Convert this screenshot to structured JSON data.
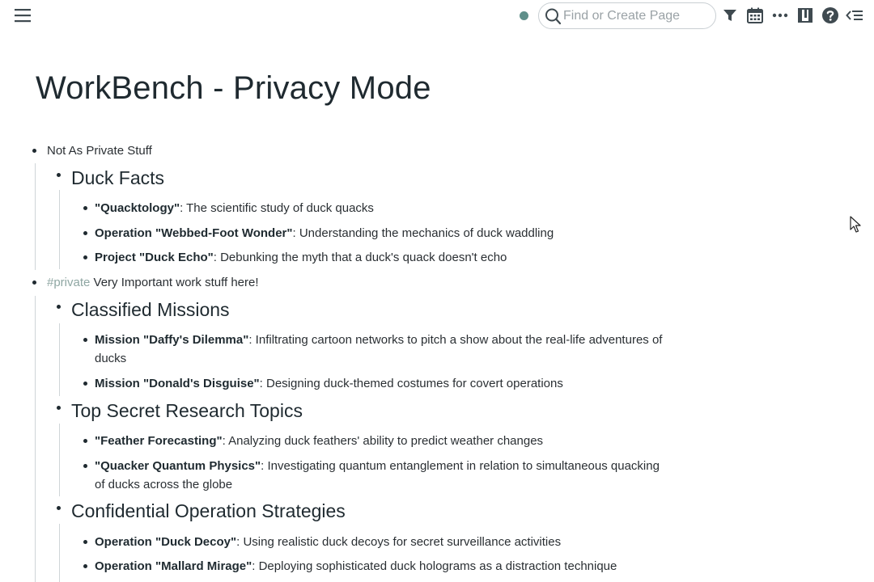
{
  "toolbar": {
    "search_placeholder": "Find or Create Page",
    "icons": [
      "menu-icon",
      "status-dot",
      "search-icon",
      "filter-icon",
      "calendar-icon",
      "more-icon",
      "sidebar-panel-icon",
      "help-icon",
      "outline-collapse-icon"
    ]
  },
  "page": {
    "title": "WorkBench - Privacy Mode"
  },
  "blocks": {
    "b1": {
      "text": "Not As Private Stuff"
    },
    "duck_facts": {
      "heading": "Duck Facts",
      "items": [
        {
          "bold": "\"Quacktology\"",
          "rest": ": The scientific study of duck quacks"
        },
        {
          "bold": "Operation \"Webbed-Foot Wonder\"",
          "rest": ": Understanding the mechanics of duck waddling"
        },
        {
          "bold": "Project \"Duck Echo\"",
          "rest": ": Debunking the myth that a duck's quack doesn't echo"
        }
      ]
    },
    "b2": {
      "tag": "#private",
      "text": " Very Important work stuff here!"
    },
    "classified": {
      "heading": "Classified Missions",
      "items": [
        {
          "bold": "Mission \"Daffy's Dilemma\"",
          "rest": ": Infiltrating cartoon networks to pitch a show about the real-life adventures of",
          "rest2": "ducks"
        },
        {
          "bold": "Mission \"Donald's Disguise\"",
          "rest": ": Designing duck-themed costumes for covert operations"
        }
      ]
    },
    "research": {
      "heading": "Top Secret Research Topics",
      "items": [
        {
          "bold": "\"Feather Forecasting\"",
          "rest": ": Analyzing duck feathers' ability to predict weather changes"
        },
        {
          "bold": "\"Quacker Quantum Physics\"",
          "rest": ": Investigating quantum entanglement in relation to simultaneous quacking",
          "rest2": "of ducks across the globe"
        }
      ]
    },
    "strategies": {
      "heading": "Confidential Operation Strategies",
      "items": [
        {
          "bold": "Operation \"Duck Decoy\"",
          "rest": ": Using realistic duck decoys for secret surveillance activities"
        },
        {
          "bold": "Operation \"Mallard Mirage\"",
          "rest": ": Deploying sophisticated duck holograms as a distraction technique"
        }
      ]
    }
  },
  "colors": {
    "text": "#1f2a30",
    "tag": "#8fa7a3",
    "status_dot": "#5f8f8a",
    "guide": "#cfd5d8"
  }
}
